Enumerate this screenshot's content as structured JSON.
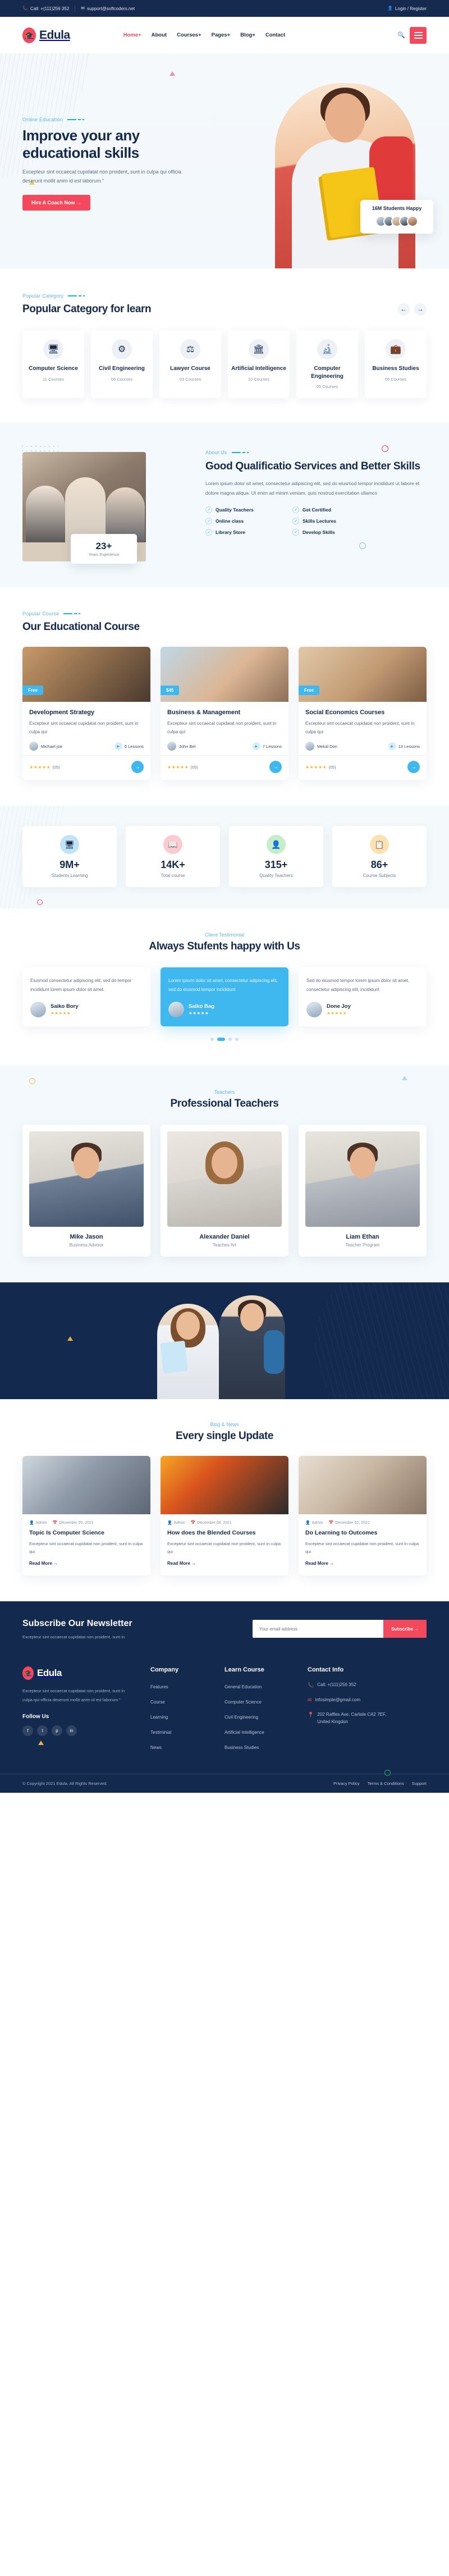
{
  "topbar": {
    "phone": "Call: +(111)256 352",
    "email": "support@softcoders.net",
    "auth": "Login / Register",
    "phone_icon": "phone-icon",
    "email_icon": "envelope-icon",
    "user_icon": "user-icon"
  },
  "header": {
    "brand": "Edula",
    "nav": [
      {
        "label": "Home+",
        "active": true
      },
      {
        "label": "About",
        "active": false
      },
      {
        "label": "Courses+",
        "active": false
      },
      {
        "label": "Pages+",
        "active": false
      },
      {
        "label": "Blog+",
        "active": false
      },
      {
        "label": "Contact",
        "active": false
      }
    ]
  },
  "hero": {
    "eyebrow": "Online Education",
    "title": "Improve your any educational skills",
    "body": "Excepteur sint occaecat cupidatat non proident, sunt in culpa qui officia deserunt mollit anim id est laborum.\"",
    "cta": "Hire A Coach Now  →",
    "students_card": {
      "title": "16M Students Happy"
    }
  },
  "popular_category": {
    "eyebrow": "Popular Category",
    "title": "Popular Category for learn",
    "prev": "←",
    "next": "→",
    "items": [
      {
        "icon": "laptop-icon",
        "glyph": "🖥",
        "title": "Computer Science",
        "courses": "11 Courses"
      },
      {
        "icon": "helmet-icon",
        "glyph": "⚙",
        "title": "Civil Engineering",
        "courses": "06 Courses"
      },
      {
        "icon": "scales-icon",
        "glyph": "⚖",
        "title": "Lawyer Course",
        "courses": "03 Courses"
      },
      {
        "icon": "building-icon",
        "glyph": "🏛",
        "title": "Artificial Intelligence",
        "courses": "10 Courses"
      },
      {
        "icon": "microscope-icon",
        "glyph": "🔬",
        "title": "Computer Engineering",
        "courses": "05 Courses"
      },
      {
        "icon": "briefcase-icon",
        "glyph": "💼",
        "title": "Business Studies",
        "courses": "05 Courses"
      }
    ]
  },
  "about": {
    "eyebrow": "About Us",
    "title": "Good Qualificatio Services and Better Skills",
    "body": "Lorem ipsum dolor sit amet, consectetur adipiscing elit, sed do eiusmod tempor incididunt ut labore et dolore magna aliqua. Ut enim ad minim veniam, quis nostrud exercitation ullamco",
    "features": [
      "Quality Teachers",
      "Get Certified",
      "Online class",
      "Skills Lectures",
      "Library Store",
      "Develop Skills"
    ],
    "badge_number": "23+",
    "badge_label": "Years Experience"
  },
  "courses": {
    "eyebrow": "Popular Course",
    "title": "Our Educational Course",
    "items": [
      {
        "price": "Free",
        "title": "Development Strategy",
        "body": "Excepteur sint occaecat cupidatat non proident, sunt in culpa qui",
        "teacher": "Michael joe",
        "lessons": "6 Lessons",
        "stars": "★★★★★",
        "rating": "(05)"
      },
      {
        "price": "$45",
        "title": "Business & Management",
        "body": "Excepteur sint occaecat cupidatat non proident, sunt in culpa qui",
        "teacher": "John Bel",
        "lessons": "7 Lessons",
        "stars": "★★★★★",
        "rating": "(05)"
      },
      {
        "price": "Free",
        "title": "Social Economics Courses",
        "body": "Excepteur sint occaecat cupidatat non proident, sunt in culpa qui",
        "teacher": "Mekal Don",
        "lessons": "13 Lessons",
        "stars": "★★★★★",
        "rating": "(05)"
      }
    ]
  },
  "stats": [
    {
      "icon": "monitor-icon",
      "glyph": "🖥",
      "number": "9M+",
      "label": "Students Learning",
      "color": "#bfe4f7"
    },
    {
      "icon": "book-icon",
      "glyph": "📖",
      "number": "14K+",
      "label": "Total course",
      "color": "#fbcbd2"
    },
    {
      "icon": "teacher-icon",
      "glyph": "👤",
      "number": "315+",
      "label": "Quality Teachers",
      "color": "#c6ecc9"
    },
    {
      "icon": "subjects-icon",
      "glyph": "📋",
      "number": "86+",
      "label": "Course Subjects",
      "color": "#fbe2b0"
    }
  ],
  "testimonials": {
    "eyebrow": "Client Testimonial",
    "title": "Always Stufents happy with Us",
    "items": [
      {
        "quote": "Eiusmod consectetur adipiscing elit, sed do tempor incididunt lorem ipsum dolor sit amet.",
        "name": "Saiko Bory",
        "stars": "★★★★★",
        "active": false
      },
      {
        "quote": "Lorem ipsum dolor sit amet, consectetur adipiscing elit, sed do eiusmod tempor incididunt",
        "name": "Saiko Bag",
        "stars": "★★★★★",
        "active": true
      },
      {
        "quote": "Sed do eiusmod tempor lorem ipsum dolor sit amet, consectetur adipiscing elit, incididunt",
        "name": "Done Joy",
        "stars": "★★★★★",
        "active": false
      }
    ]
  },
  "teachers": {
    "eyebrow": "Teachers",
    "title": "Professional Teachers",
    "items": [
      {
        "name": "Mike Jason",
        "role": "Business Advisor"
      },
      {
        "name": "Alexander Daniel",
        "role": "Teaches Art"
      },
      {
        "name": "Liam Ethan",
        "role": "Teacher Program"
      }
    ]
  },
  "blog": {
    "eyebrow": "Blog & News",
    "title": "Every single Update",
    "items": [
      {
        "author": "Admin",
        "date": "December 05, 2021",
        "title": "Topic Is Computer Science",
        "body": "Excepteur sint occaecat cupidatat non proident, sunt in culpa qui",
        "read_more": "Read More →"
      },
      {
        "author": "Admin",
        "date": "December 08, 2021",
        "title": "How does the Blended Courses",
        "body": "Excepteur sint occaecat cupidatat non proident, sunt in culpa qui",
        "read_more": "Read More →"
      },
      {
        "author": "Admin",
        "date": "December 02, 2021",
        "title": "Do Learning to Outcomes",
        "body": "Excepteur sint occaecat cupidatat non proident, sunt in culpa qui",
        "read_more": "Read More →"
      }
    ]
  },
  "newsletter": {
    "title": "Subscribe Our Newsletter",
    "body": "Excepteur sint occaecat cupidatat non proident, sunt in",
    "placeholder": "Your email address",
    "button": "Subscribe →"
  },
  "footer": {
    "brand": "Edula",
    "about": "Excepteur sint occaecat cupidatat non proident, sunt in culpa qui officia deserunt mollit anim id est laborum.\"",
    "follow_title": "Follow Us",
    "socials": [
      {
        "name": "facebook-icon",
        "glyph": "f"
      },
      {
        "name": "twitter-icon",
        "glyph": "t"
      },
      {
        "name": "pinterest-icon",
        "glyph": "p"
      },
      {
        "name": "linkedin-icon",
        "glyph": "in"
      }
    ],
    "company": {
      "title": "Company",
      "links": [
        "Features",
        "Course",
        "Learning",
        "Testiminial",
        "News"
      ]
    },
    "learn": {
      "title": "Learn Course",
      "links": [
        "General Education",
        "Computer Science",
        "Civil Engineering",
        "Artificial Intelligence",
        "Business Studies"
      ]
    },
    "contact": {
      "title": "Contact Info",
      "phone": "Call: +(111)256 352",
      "email": "infosimple@gmail.com",
      "address": "202 Raffles Ave, Carlisle CA2 7EF, United Kingdon"
    },
    "copyright": "© Copyright 2021 Edula. All Rights Reserved.",
    "bottom_links": [
      "Privacy Policy",
      "Terms & Conditions",
      "Support"
    ]
  }
}
